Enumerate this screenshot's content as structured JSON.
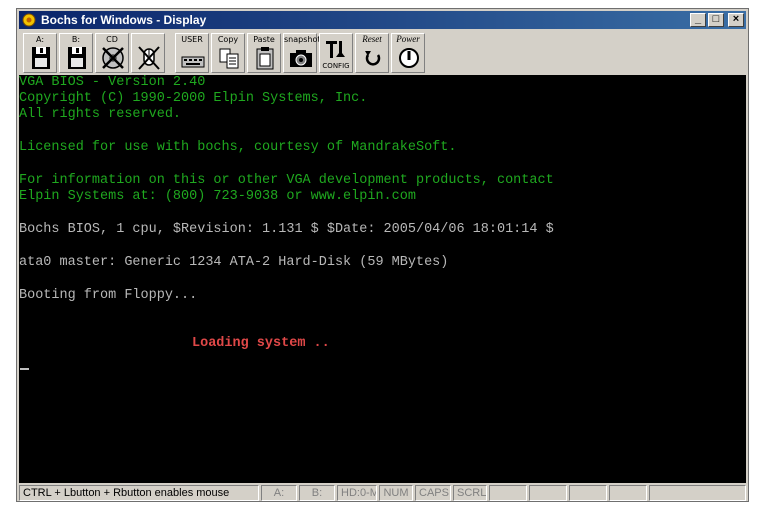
{
  "window": {
    "title": "Bochs for Windows - Display"
  },
  "toolbar": {
    "buttons": [
      {
        "label": "A:",
        "icon": "floppy-a-icon"
      },
      {
        "label": "B:",
        "icon": "floppy-b-icon"
      },
      {
        "label": "CD",
        "icon": "cdrom-icon"
      },
      {
        "label": "",
        "icon": "mouse-icon"
      },
      {
        "label": "USER",
        "icon": "keyboard-icon"
      },
      {
        "label": "Copy",
        "icon": "copy-icon"
      },
      {
        "label": "Paste",
        "icon": "paste-icon"
      },
      {
        "label": "snapshot",
        "icon": "camera-icon"
      },
      {
        "label": "CONFIG",
        "icon": "config-icon"
      },
      {
        "label": "Reset",
        "icon": "reset-icon"
      },
      {
        "label": "Power",
        "icon": "power-icon"
      }
    ]
  },
  "screen": {
    "bios_line1": "VGA BIOS - Version 2.40",
    "bios_line2": "Copyright (C) 1990-2000 Elpin Systems, Inc.",
    "bios_line3": "All rights reserved.",
    "license": "Licensed for use with bochs, courtesy of MandrakeSoft.",
    "info_line1": "For information on this or other VGA development products, contact",
    "info_line2": "Elpin Systems at: (800) 723-9038 or www.elpin.com",
    "bochs_bios": "Bochs BIOS, 1 cpu, $Revision: 1.131 $ $Date: 2005/04/06 18:01:14 $",
    "ata": "ata0 master: Generic 1234 ATA-2 Hard-Disk (59 MBytes)",
    "boot": "Booting from Floppy...",
    "loading": "Loading system .."
  },
  "status": {
    "message": "CTRL + Lbutton + Rbutton enables mouse",
    "a": "A:",
    "b": "B:",
    "hd": "HD:0-M",
    "num": "NUM",
    "caps": "CAPS",
    "scrl": "SCRL"
  },
  "colors": {
    "bios_text": "#1fa81f",
    "plain_text": "#b8b8b8",
    "loading_text": "#e04848"
  }
}
